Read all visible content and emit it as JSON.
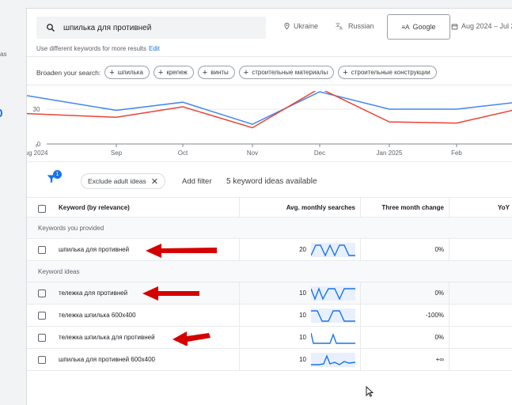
{
  "search": {
    "query": "шпилька для противней"
  },
  "location": "Ukraine",
  "language": "Russian",
  "network": "Google",
  "date_range": "Aug 2024 – Jul 2",
  "hint": {
    "text": "Use different keywords for more results",
    "link": "Edit"
  },
  "broaden": {
    "label": "Broaden your search:",
    "chips": [
      "шпилька",
      "крепеж",
      "винты",
      "строительные материалы",
      "строительные конструкции"
    ]
  },
  "left_fragment": "as",
  "chart_data": {
    "type": "line",
    "x": [
      "ug 2024",
      "Sep",
      "Oct",
      "Nov",
      "Dec",
      "Jan 2025",
      "Feb"
    ],
    "y_ticks": [
      "30",
      "0"
    ],
    "series": [
      {
        "color": "#4285f4",
        "values": [
          null,
          29,
          36,
          17,
          45,
          30,
          30,
          36
        ]
      },
      {
        "color": "#ea4335",
        "values": [
          null,
          23,
          32,
          14,
          48,
          19,
          18,
          30
        ]
      }
    ]
  },
  "filters": {
    "badge": "1",
    "chip": "Exclude adult ideas",
    "add_filter": "Add filter",
    "count_text": "5 keyword ideas available"
  },
  "table": {
    "headers": {
      "keyword": "Keyword (by relevance)",
      "avg": "Avg. monthly searches",
      "three_month": "Three month change",
      "yoy": "YoY"
    },
    "group_provided": "Keywords you provided",
    "group_ideas": "Keyword ideas",
    "provided": [
      {
        "keyword": "шпилька для противней",
        "avg": "20",
        "three_month": "0%",
        "yoy": ""
      }
    ],
    "ideas": [
      {
        "keyword": "тележка для противней",
        "avg": "10",
        "three_month": "0%",
        "yoy": ""
      },
      {
        "keyword": "тележка шпилька 600х400",
        "avg": "10",
        "three_month": "-100%",
        "yoy": ""
      },
      {
        "keyword": "тележка шпилька для противней",
        "avg": "10",
        "three_month": "0%",
        "yoy": ""
      },
      {
        "keyword": "шпилька для противней 600х400",
        "avg": "10",
        "three_month": "+∞",
        "yoy": ""
      }
    ]
  },
  "colors": {
    "accent": "#1a73e8",
    "annotation_arrow": "#d50000"
  }
}
